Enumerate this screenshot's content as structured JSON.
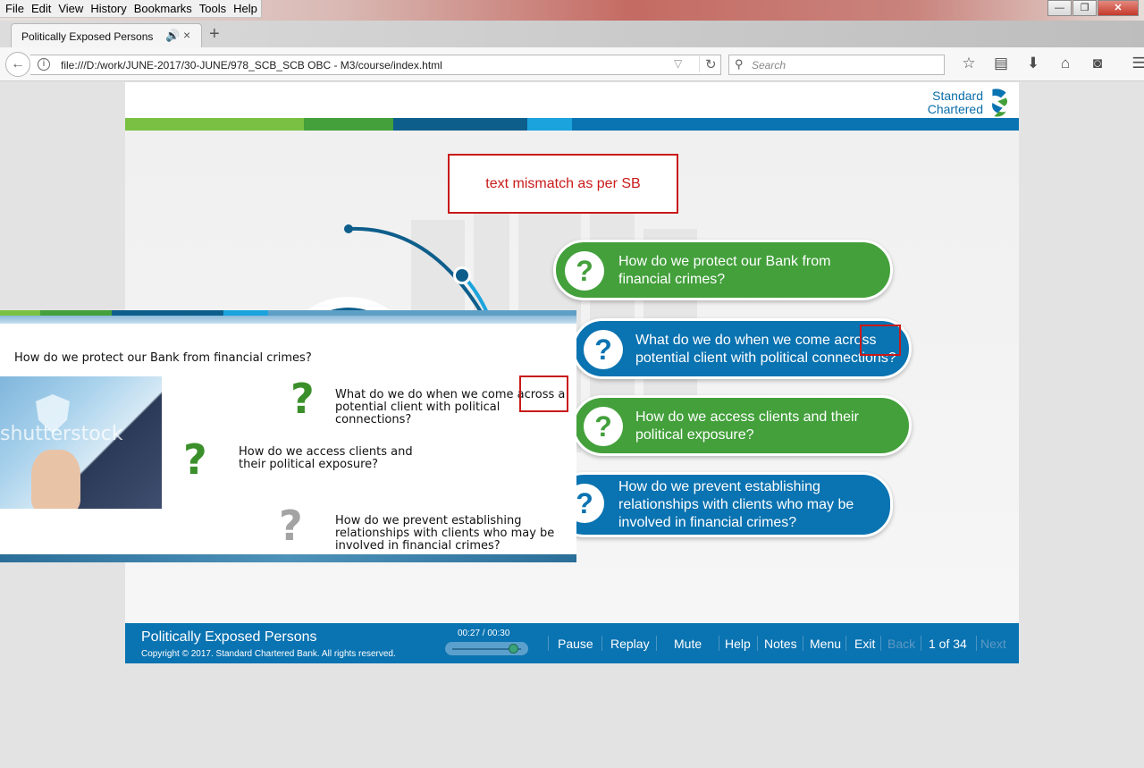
{
  "browser": {
    "menu": [
      "File",
      "Edit",
      "View",
      "History",
      "Bookmarks",
      "Tools",
      "Help"
    ],
    "window_controls": [
      "—",
      "❐",
      "✕"
    ],
    "tab": {
      "title": "Politically Exposed Persons",
      "audio_icon": "speaker-icon",
      "close": "×"
    },
    "new_tab": "+",
    "url": "file:///D:/work/JUNE-2017/30-JUNE/978_SCB_SCB OBC - M3/course/index.html",
    "search_placeholder": "Search",
    "toolbar_icons": [
      "bookmark-star-icon",
      "reading-list-icon",
      "download-icon",
      "home-icon",
      "pocket-icon",
      "hamburger-menu-icon"
    ]
  },
  "course": {
    "logo_line1": "Standard",
    "logo_line2": "Chartered",
    "annotation": "text mismatch as per SB",
    "brand_colors": {
      "green": "#43a03b",
      "blue": "#0a73b1",
      "light_green": "#7ac143",
      "navy": "#0e5e8c",
      "cyan": "#1aa3dd"
    },
    "bubbles": [
      {
        "text_line1": "How do we protect our Bank from",
        "text_line2": "financial crimes?",
        "color": "green"
      },
      {
        "text_line1": "What do we do when we come across",
        "text_line2": "potential client with political connections?",
        "color": "blue"
      },
      {
        "text_line1": "How do we access clients and their",
        "text_line2": "political exposure?",
        "color": "green"
      },
      {
        "text_line1": "How do we prevent establishing",
        "text_line2": "relationships with clients who may be",
        "text_line3": "involved in financial crimes?",
        "color": "blue"
      }
    ],
    "storyboard": {
      "q1": "How do we protect our Bank from financial crimes?",
      "q2_line1": "What do we do when we come across a",
      "q2_line2": "potential client with political",
      "q2_line3": "connections?",
      "q3_line1": "How do we access clients and",
      "q3_line2": "their political exposure?",
      "q4_line1": "How do we prevent establishing",
      "q4_line2": "relationships with clients who may be",
      "q4_line3": "involved in financial crimes?",
      "watermark": "shutterstock"
    }
  },
  "footer": {
    "title": "Politically Exposed Persons",
    "copyright": "Copyright © 2017. Standard Chartered Bank. All rights reserved.",
    "time": "00:27 / 00:30",
    "playback_fraction": 0.9,
    "buttons": {
      "pause": "Pause",
      "replay": "Replay",
      "mute": "Mute",
      "help": "Help",
      "notes": "Notes",
      "menu": "Menu",
      "exit": "Exit",
      "back": "Back",
      "next": "Next"
    },
    "page": "1 of 34"
  }
}
